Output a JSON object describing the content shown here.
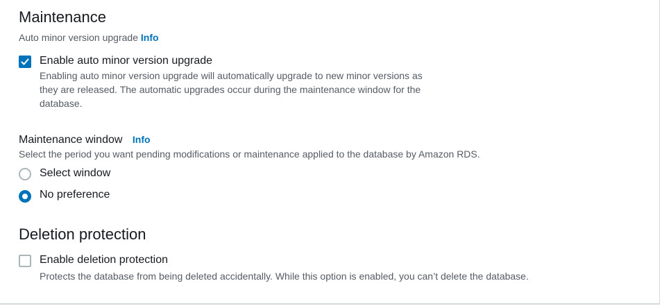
{
  "maintenance": {
    "title": "Maintenance",
    "auto_upgrade_label": "Auto minor version upgrade",
    "info": "Info",
    "auto_upgrade_checkbox": {
      "label": "Enable auto minor version upgrade",
      "checked": true,
      "description_lines": [
        "Enabling auto minor version upgrade will automatically upgrade to new minor versions as",
        "they are released. The automatic upgrades occur during the maintenance window for the",
        "database."
      ]
    },
    "window": {
      "label": "Maintenance window",
      "info": "Info",
      "description": "Select the period you want pending modifications or maintenance applied to the database by Amazon RDS.",
      "options": [
        {
          "label": "Select window",
          "selected": false
        },
        {
          "label": "No preference",
          "selected": true
        }
      ]
    }
  },
  "deletion": {
    "title": "Deletion protection",
    "checkbox": {
      "label": "Enable deletion protection",
      "checked": false,
      "description": "Protects the database from being deleted accidentally. While this option is enabled, you can’t delete the database."
    }
  },
  "colors": {
    "accent": "#0073bb",
    "text": "#16191f",
    "secondary_text": "#545b64",
    "border": "#aab7b8"
  }
}
